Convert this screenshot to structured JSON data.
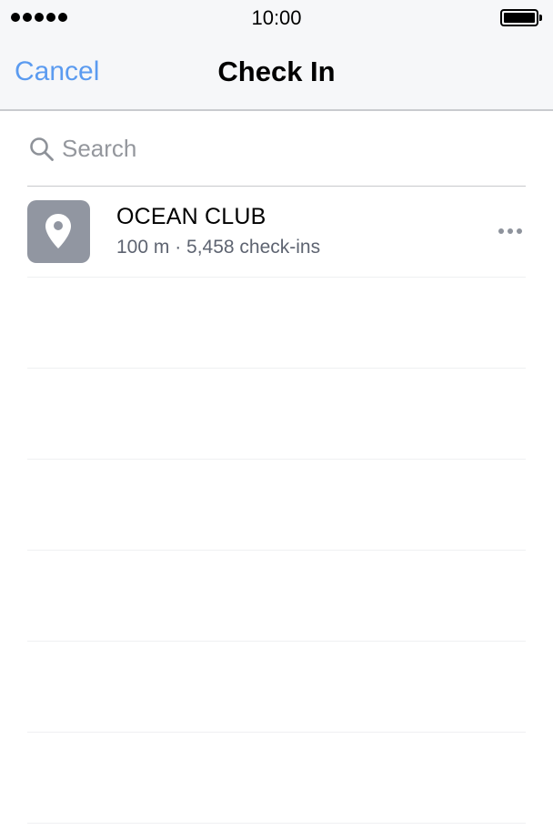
{
  "status_bar": {
    "time": "10:00",
    "signal_icon": "signal-dots-icon",
    "battery_icon": "battery-full-icon"
  },
  "nav": {
    "cancel_label": "Cancel",
    "title": "Check In"
  },
  "search": {
    "placeholder": "Search",
    "icon": "search-icon"
  },
  "places": [
    {
      "name": "OCEAN CLUB",
      "meta": "100 m · 5,458 check-ins",
      "icon": "location-pin-icon",
      "more_icon": "more-icon"
    }
  ],
  "colors": {
    "accent": "#5b9bf0",
    "bar_background": "#f6f7f9",
    "pin_tile": "#9196a1",
    "secondary_text": "#5e6471",
    "placeholder_text": "#94979d"
  }
}
